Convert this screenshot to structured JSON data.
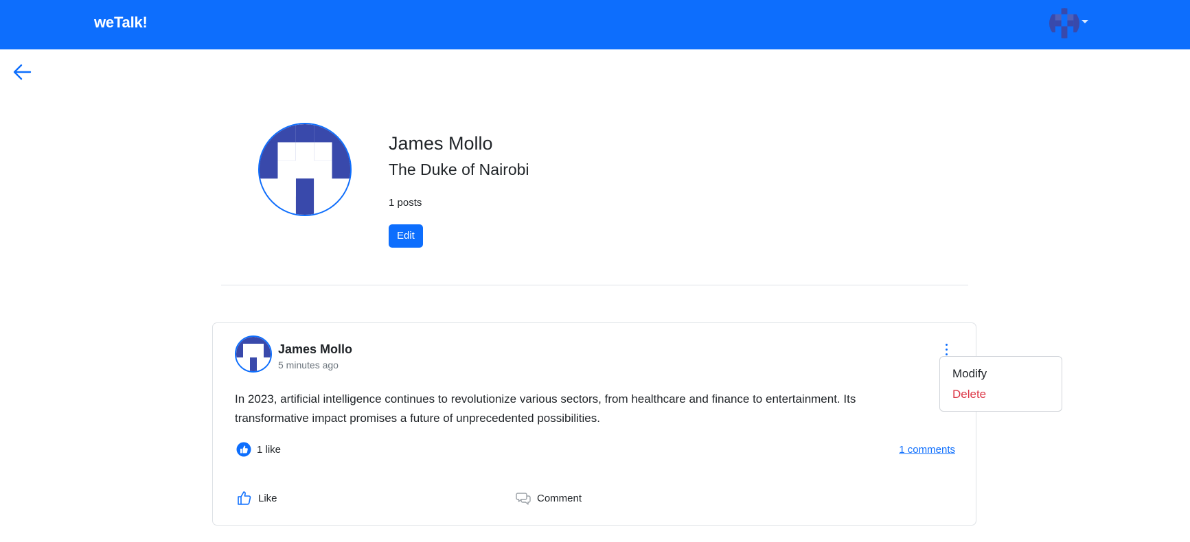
{
  "navbar": {
    "brand": "weTalk!",
    "avatar_icon": "identicon-avatar",
    "menu_caret_icon": "caret-down-icon",
    "bg_color": "#0d6efd"
  },
  "back_button": {
    "icon": "arrow-left-icon"
  },
  "profile": {
    "name": "James Mollo",
    "title": "The Duke of Nairobi",
    "posts_count": "1 posts",
    "edit_label": "Edit",
    "avatar_color": "#3949ab"
  },
  "post": {
    "author": "James Mollo",
    "time": "5 minutes ago",
    "text": "In 2023, artificial intelligence continues to revolutionize various sectors, from healthcare and finance to entertainment. Its transformative impact promises a future of unprecedented possibilities.",
    "likes": "1 like",
    "comments_link": "1 comments",
    "like_action": "Like",
    "comment_action": "Comment"
  },
  "post_menu": {
    "modify": "Modify",
    "delete": "Delete",
    "delete_color": "#dc3545"
  }
}
